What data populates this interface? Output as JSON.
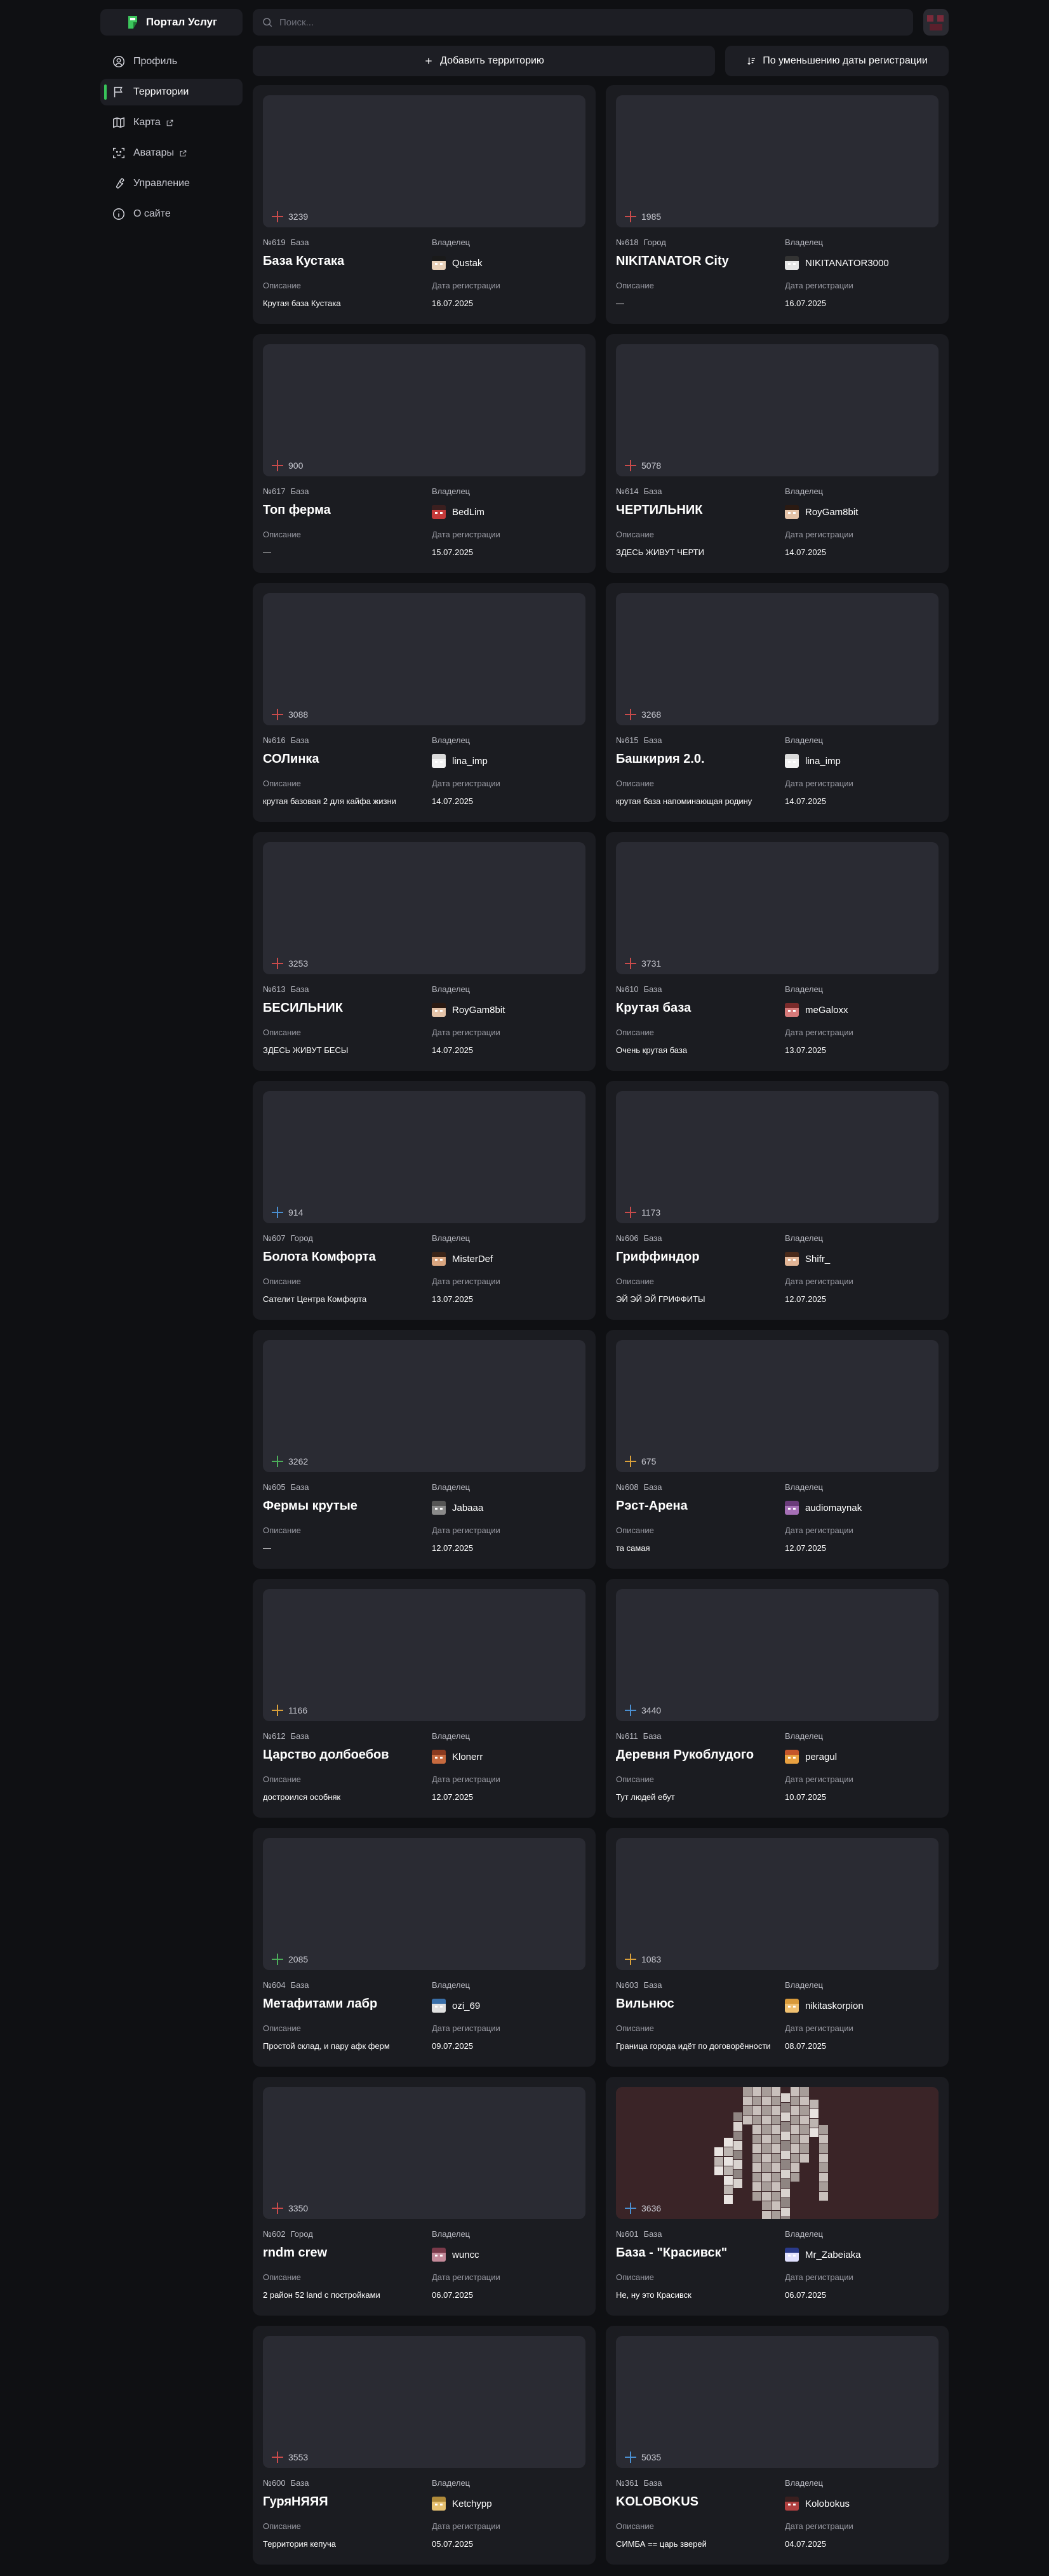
{
  "app": {
    "title": "Портал Услуг"
  },
  "sidebar": {
    "items": [
      {
        "label": "Профиль",
        "icon": "user-circle-icon",
        "active": false,
        "external": false
      },
      {
        "label": "Территории",
        "icon": "flag-icon",
        "active": true,
        "external": false
      },
      {
        "label": "Карта",
        "icon": "map-icon",
        "active": false,
        "external": true
      },
      {
        "label": "Аватары",
        "icon": "scan-face-icon",
        "active": false,
        "external": true
      },
      {
        "label": "Управление",
        "icon": "wrench-icon",
        "active": false,
        "external": false
      },
      {
        "label": "О сайте",
        "icon": "info-icon",
        "active": false,
        "external": false
      }
    ]
  },
  "search": {
    "placeholder": "Поиск...",
    "value": ""
  },
  "toolbar": {
    "add_label": "Добавить территорию",
    "sort_label": "По уменьшению даты регистрации"
  },
  "labels": {
    "owner": "Владелец",
    "description": "Описание",
    "reg_date": "Дата регистрации"
  },
  "territories": [
    {
      "num": "№619",
      "type": "База",
      "name": "База Кустака",
      "owner": "Qustak",
      "description": "Крутая база Кустака",
      "date": "16.07.2025",
      "coords": "3239",
      "cross_color": "#c94b4b",
      "avatar": [
        "#1a1a1a",
        "#e8d0b8"
      ]
    },
    {
      "num": "№618",
      "type": "Город",
      "name": "NIKITANATOR City",
      "owner": "NIKITANATOR3000",
      "description": "—",
      "date": "16.07.2025",
      "coords": "1985",
      "cross_color": "#c94b4b",
      "avatar": [
        "#333333",
        "#e6e6e6"
      ]
    },
    {
      "num": "№617",
      "type": "База",
      "name": "Топ ферма",
      "owner": "BedLim",
      "description": "—",
      "date": "15.07.2025",
      "coords": "900",
      "cross_color": "#c94b4b",
      "avatar": [
        "#3b1f1f",
        "#c43a3a"
      ]
    },
    {
      "num": "№614",
      "type": "База",
      "name": "ЧЕРТИЛЬНИК",
      "owner": "RoyGam8bit",
      "description": "ЗДЕСЬ ЖИВУТ ЧЕРТИ",
      "date": "14.07.2025",
      "coords": "5078",
      "cross_color": "#c94b4b",
      "avatar": [
        "#2b1a12",
        "#e4c3a8"
      ]
    },
    {
      "num": "№616",
      "type": "База",
      "name": "СОЛинка",
      "owner": "lina_imp",
      "description": "крутая базовая 2 для кайфа жизни",
      "date": "14.07.2025",
      "coords": "3088",
      "cross_color": "#c94b4b",
      "avatar": [
        "#d9d9d9",
        "#f2f2f2"
      ]
    },
    {
      "num": "№615",
      "type": "База",
      "name": "Башкирия 2.0.",
      "owner": "lina_imp",
      "description": "крутая база напоминающая родину",
      "date": "14.07.2025",
      "coords": "3268",
      "cross_color": "#c94b4b",
      "avatar": [
        "#d9d9d9",
        "#f2f2f2"
      ]
    },
    {
      "num": "№613",
      "type": "База",
      "name": "БЕСИЛЬНИК",
      "owner": "RoyGam8bit",
      "description": "ЗДЕСЬ ЖИВУТ БЕСЫ",
      "date": "14.07.2025",
      "coords": "3253",
      "cross_color": "#c94b4b",
      "avatar": [
        "#2b1a12",
        "#e4c3a8"
      ]
    },
    {
      "num": "№610",
      "type": "База",
      "name": "Крутая база",
      "owner": "meGaloxx",
      "description": "Очень крутая база",
      "date": "13.07.2025",
      "coords": "3731",
      "cross_color": "#c94b4b",
      "avatar": [
        "#7a2b2b",
        "#d77a7a"
      ]
    },
    {
      "num": "№607",
      "type": "Город",
      "name": "Болота Комфорта",
      "owner": "MisterDef",
      "description": "Сателит Центра Комфорта",
      "date": "13.07.2025",
      "coords": "914",
      "cross_color": "#4a8fd1",
      "avatar": [
        "#3a2418",
        "#d9a57f"
      ]
    },
    {
      "num": "№606",
      "type": "База",
      "name": "Гриффиндор",
      "owner": "Shifr_",
      "description": "ЭЙ ЭЙ ЭЙ ГРИФФИТЫ",
      "date": "12.07.2025",
      "coords": "1173",
      "cross_color": "#c94b4b",
      "avatar": [
        "#4a2a1a",
        "#e2b596"
      ]
    },
    {
      "num": "№605",
      "type": "База",
      "name": "Фермы крутые",
      "owner": "Jabaaa",
      "description": "—",
      "date": "12.07.2025",
      "coords": "3262",
      "cross_color": "#4cae5a",
      "avatar": [
        "#555555",
        "#8a8a8a"
      ]
    },
    {
      "num": "№608",
      "type": "База",
      "name": "Рэст-Арена",
      "owner": "audiomaynak",
      "description": "та самая",
      "date": "12.07.2025",
      "coords": "675",
      "cross_color": "#d9a03a",
      "avatar": [
        "#6a3b7a",
        "#a56fb5"
      ]
    },
    {
      "num": "№612",
      "type": "База",
      "name": "Царство долбоебов",
      "owner": "Klonerr",
      "description": "достроился особняк",
      "date": "12.07.2025",
      "coords": "1166",
      "cross_color": "#d9a03a",
      "avatar": [
        "#8a3a1f",
        "#c76a3f"
      ]
    },
    {
      "num": "№611",
      "type": "База",
      "name": "Деревня Рукоблудого",
      "owner": "peragul",
      "description": "Тут людей ебут",
      "date": "10.07.2025",
      "coords": "3440",
      "cross_color": "#4a8fd1",
      "avatar": [
        "#c4552a",
        "#e8a040"
      ]
    },
    {
      "num": "№604",
      "type": "База",
      "name": "Метафитами лабр",
      "owner": "ozi_69",
      "description": "Простой склад, и пару афк ферм",
      "date": "09.07.2025",
      "coords": "2085",
      "cross_color": "#4cae5a",
      "avatar": [
        "#3a6fa8",
        "#e0e0e0"
      ]
    },
    {
      "num": "№603",
      "type": "База",
      "name": "Вильнюс",
      "owner": "nikitaskorpion",
      "description": "Граница города идёт по договорённости",
      "date": "08.07.2025",
      "coords": "1083",
      "cross_color": "#d9a03a",
      "avatar": [
        "#d99a3a",
        "#f0c070"
      ]
    },
    {
      "num": "№602",
      "type": "Город",
      "name": "rndm crew",
      "owner": "wuncc",
      "description": "2 район 52 land с постройками",
      "date": "06.07.2025",
      "coords": "3350",
      "cross_color": "#c94b4b",
      "avatar": [
        "#7a3a4a",
        "#c48a9a"
      ]
    },
    {
      "num": "№601",
      "type": "База",
      "name": "База - \"Красивск\"",
      "owner": "Mr_Zabeiaka",
      "description": "Не, ну это Красивск",
      "date": "06.07.2025",
      "coords": "3636",
      "cross_color": "#4a8fd1",
      "avatar": [
        "#2a3a8a",
        "#e0e0ff"
      ],
      "has_image": true
    },
    {
      "num": "№600",
      "type": "База",
      "name": "ГуряНЯЯЯ",
      "owner": "Ketchypp",
      "description": "Территория кепуча",
      "date": "05.07.2025",
      "coords": "3553",
      "cross_color": "#c94b4b",
      "avatar": [
        "#b08a3a",
        "#e6c070"
      ]
    },
    {
      "num": "№361",
      "type": "База",
      "name": "KOLOBOKUS",
      "owner": "Kolobokus",
      "description": "СИМБА == царь зверей",
      "date": "04.07.2025",
      "coords": "5035",
      "cross_color": "#4a8fd1",
      "avatar": [
        "#3a1f1f",
        "#b04040"
      ]
    }
  ]
}
